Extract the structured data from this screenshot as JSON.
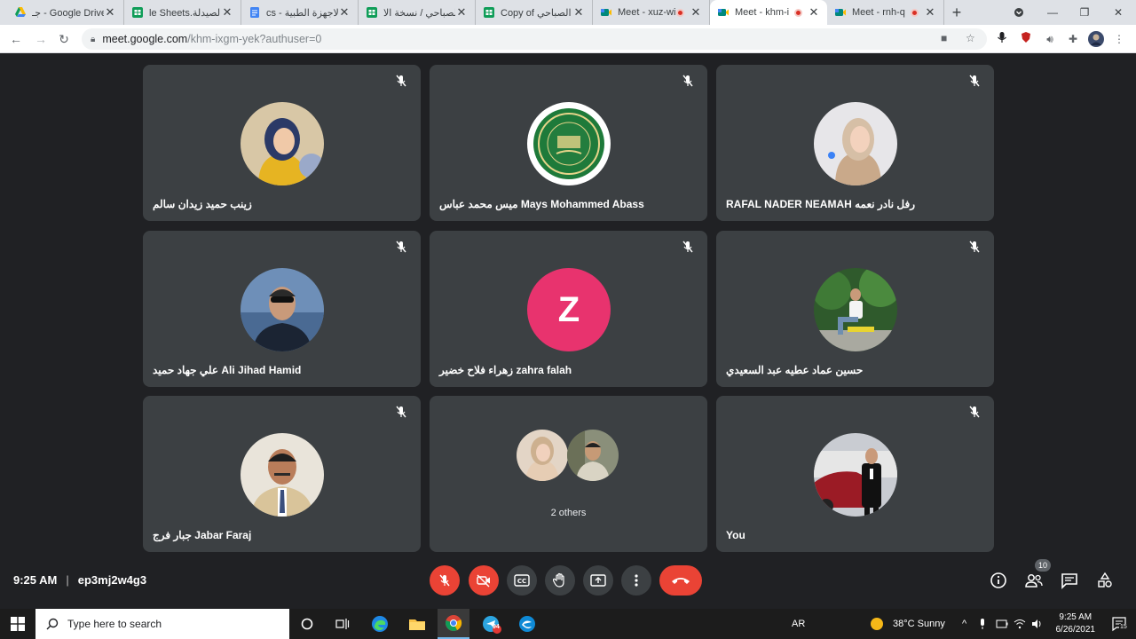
{
  "browser": {
    "tabs": [
      {
        "title": "جـ - Google Drive",
        "favicon": "google-drive-icon",
        "color": "#1e8e3e",
        "recording": false
      },
      {
        "title": "le Sheets.الصيدلة",
        "favicon": "google-sheets-icon",
        "color": "#0f9d58",
        "recording": false
      },
      {
        "title": "cs - الاجهزة الطبية",
        "favicon": "google-docs-icon",
        "color": "#4285f4",
        "recording": false
      },
      {
        "title": "الصباحي / نسخة الا",
        "favicon": "google-sheets-icon",
        "color": "#0f9d58",
        "recording": false
      },
      {
        "title": "Copy of الصباحي",
        "favicon": "google-sheets-icon",
        "color": "#0f9d58",
        "recording": false
      },
      {
        "title": "Meet - xuz-wi",
        "favicon": "google-meet-icon",
        "color": "#00897b",
        "recording": true
      },
      {
        "title": "Meet - khm-i",
        "favicon": "google-meet-icon",
        "color": "#00897b",
        "recording": true
      },
      {
        "title": "Meet - rnh-q",
        "favicon": "google-meet-icon",
        "color": "#00897b",
        "recording": true
      }
    ],
    "active_tab": 6,
    "url_host": "meet.google.com",
    "url_path": "/khm-ixgm-yek?authuser=0"
  },
  "participants": [
    {
      "name": "زينب حميد زيدان سالم",
      "avatar": "photo-woman-hijab",
      "muted": true
    },
    {
      "name": "ميس محمد عباس Mays Mohammed Abass",
      "avatar": "university-logo",
      "muted": true
    },
    {
      "name": "RAFAL NADER NEAMAH رفل نادر نعمه",
      "avatar": "photo-woman-beige",
      "muted": true
    },
    {
      "name": "علي جهاد حميد Ali Jihad Hamid",
      "avatar": "photo-man-sunglasses",
      "muted": true
    },
    {
      "name": "زهراء فلاح خضير zahra falah",
      "avatar_letter": "Z",
      "muted": true
    },
    {
      "name": "حسين عماد عطيه عبد السعيدي",
      "avatar": "photo-man-sitting",
      "muted": true
    },
    {
      "name": "جبار فرج Jabar Faraj",
      "avatar": "photo-man-suit",
      "muted": true
    },
    {
      "name": "You",
      "avatar": "photo-man-car",
      "muted": true
    }
  ],
  "others_tile": {
    "label": "2 others"
  },
  "meeting": {
    "time": "9:25 AM",
    "code": "ep3mj2w4g3",
    "people_count": "10"
  },
  "taskbar": {
    "search_placeholder": "Type here to search",
    "language": "AR",
    "weather": "38°C  Sunny",
    "clock_time": "9:25 AM",
    "clock_date": "6/26/2021",
    "notifications": "15",
    "telegram_badge": "94"
  },
  "colors": {
    "meet_bg": "#202124",
    "tile_bg": "#3c4043",
    "red": "#ea4335",
    "avatar_pink": "#e8336e"
  }
}
